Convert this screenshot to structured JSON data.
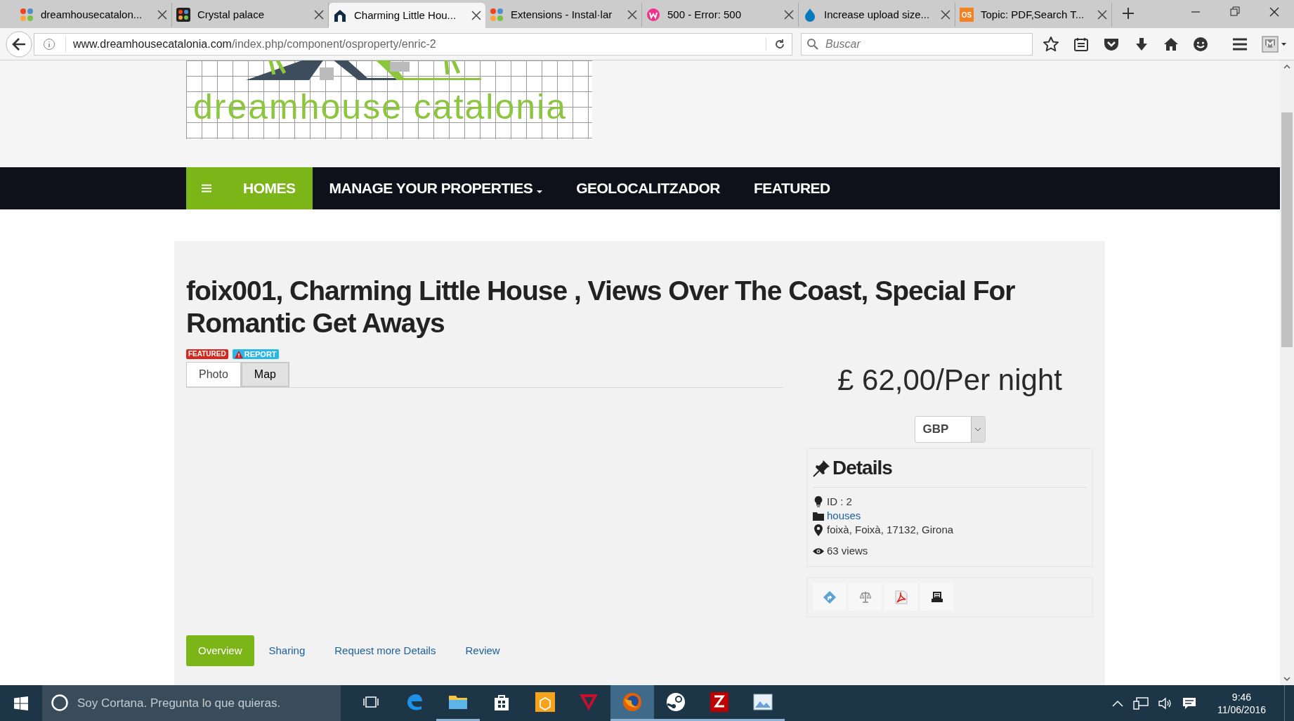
{
  "browser": {
    "tabs": [
      {
        "title": "dreamhousecatalon...",
        "kind": "joomla",
        "selected": false
      },
      {
        "title": "Crystal palace",
        "kind": "joomla-dark",
        "selected": false
      },
      {
        "title": "Charming Little Hou...",
        "kind": "house",
        "selected": true
      },
      {
        "title": "Extensions - Instal·lar",
        "kind": "joomla",
        "selected": false
      },
      {
        "title": "500 - Error: 500",
        "kind": "wamp",
        "selected": false
      },
      {
        "title": "Increase upload size...",
        "kind": "drupal",
        "selected": false
      },
      {
        "title": "Topic: PDF,Search T...",
        "kind": "os",
        "icon_text": "OS",
        "selected": false
      }
    ],
    "address": {
      "domain": "www.dreamhousecatalonia.com",
      "path": "/index.php/component/osproperty/enric-2"
    },
    "search": {
      "placeholder": "Buscar"
    }
  },
  "site": {
    "logo_text": "dreamhouse catalonia",
    "nav": [
      {
        "label": "HOMES",
        "selected": true,
        "dropdown": false
      },
      {
        "label": "MANAGE YOUR PROPERTIES",
        "selected": false,
        "dropdown": true
      },
      {
        "label": "GEOLOCALITZADOR",
        "selected": false,
        "dropdown": false
      },
      {
        "label": "FEATURED",
        "selected": false,
        "dropdown": false
      }
    ]
  },
  "property": {
    "title": "foix001, Charming Little House , Views Over The Coast, Special For Romantic Get Aways",
    "badges": [
      {
        "label": "FEATURED",
        "kind": "featured"
      },
      {
        "label": "REPORT",
        "kind": "report"
      }
    ],
    "media_tabs": [
      {
        "label": "Photo",
        "selected": true
      },
      {
        "label": "Map",
        "selected": false
      }
    ],
    "price": "£ 62,00/Per night",
    "currency": "GBP",
    "details": {
      "heading": "Details",
      "rows": [
        {
          "kind": "id",
          "text": "ID : 2"
        },
        {
          "kind": "category",
          "text": "houses"
        },
        {
          "kind": "location",
          "text": "foixà, Foixà, 17132, Girona"
        },
        {
          "kind": "views",
          "text": "63 views"
        }
      ]
    },
    "actions": [
      {
        "kind": "share"
      },
      {
        "kind": "compare"
      },
      {
        "kind": "pdf"
      },
      {
        "kind": "print"
      }
    ],
    "sections": [
      {
        "label": "Overview",
        "selected": true
      },
      {
        "label": "Sharing",
        "selected": false
      },
      {
        "label": "Request more Details",
        "selected": false
      },
      {
        "label": "Review",
        "selected": false
      }
    ]
  },
  "taskbar": {
    "search_placeholder": "Soy Cortana. Pregunta lo que quieras.",
    "apps": [
      {
        "kind": "task-view",
        "running": false,
        "selected": false
      },
      {
        "kind": "edge",
        "running": false,
        "selected": false
      },
      {
        "kind": "explorer",
        "running": true,
        "selected": false
      },
      {
        "kind": "store",
        "running": false,
        "selected": false
      },
      {
        "kind": "package",
        "running": false,
        "selected": false
      },
      {
        "kind": "red-logo",
        "running": false,
        "selected": false
      },
      {
        "kind": "firefox",
        "running": true,
        "selected": true
      },
      {
        "kind": "steam",
        "running": true,
        "selected": false
      },
      {
        "kind": "filezilla",
        "running": true,
        "selected": false
      },
      {
        "kind": "image-viewer",
        "running": true,
        "selected": false
      }
    ],
    "time": "9:46",
    "date": "11/06/2016"
  }
}
